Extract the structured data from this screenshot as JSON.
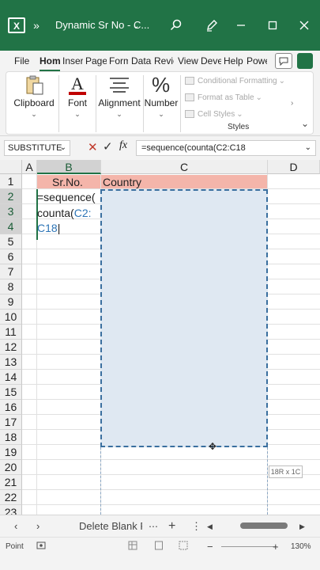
{
  "window": {
    "title": "Dynamic Sr No  -  C...",
    "accent": "#217346"
  },
  "ribbon_tabs": [
    "File",
    "Home",
    "Insert",
    "Page",
    "Form",
    "Data",
    "Revie",
    "View",
    "Deve",
    "Help",
    "Powe"
  ],
  "ribbon": {
    "clipboard": "Clipboard",
    "font": "Font",
    "alignment": "Alignment",
    "number": "Number",
    "cond_format": "Conditional Formatting",
    "format_table": "Format as Table",
    "cell_styles": "Cell Styles",
    "styles_group": "Styles"
  },
  "formula_bar": {
    "name_box": "SUBSTITUTE",
    "formula": "=sequence(counta(C2:C18"
  },
  "columns": [
    "A",
    "B",
    "C",
    "D"
  ],
  "rows": [
    "1",
    "2",
    "3",
    "4",
    "5",
    "6",
    "7",
    "8",
    "9",
    "10",
    "11",
    "12",
    "13",
    "14",
    "15",
    "16",
    "17",
    "18",
    "19",
    "20",
    "21",
    "22",
    "23"
  ],
  "cells": {
    "B1": "Sr.No.",
    "C1": "Country",
    "B2_line1": "=sequence(",
    "B2_line2_a": "counta(",
    "B2_line2_b": "C2:",
    "B2_line3": "C18"
  },
  "range_tooltip": "18R x 1C",
  "sheet": {
    "name": "Delete Blank Ro"
  },
  "status": {
    "mode": "Point",
    "zoom": "130%"
  },
  "colors": {
    "header_fill": "#f4b5aa",
    "range_fill": "#dfe8f2",
    "ref_blue": "#2e75b6"
  }
}
